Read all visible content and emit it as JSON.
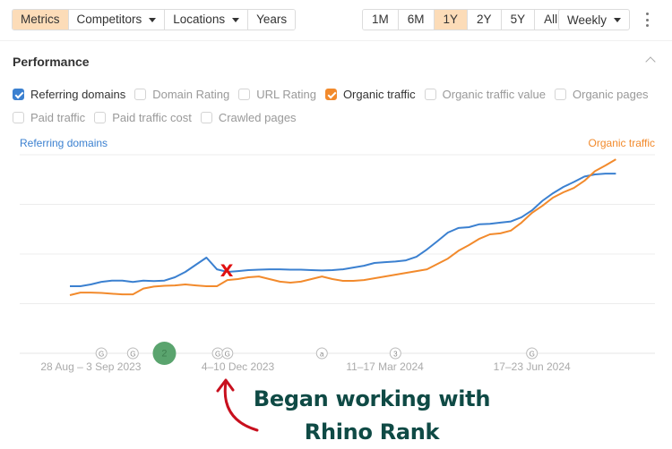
{
  "toolbar": {
    "tabs": [
      {
        "label": "Metrics",
        "active": true,
        "dropdown": false
      },
      {
        "label": "Competitors",
        "active": false,
        "dropdown": true
      },
      {
        "label": "Locations",
        "active": false,
        "dropdown": true
      },
      {
        "label": "Years",
        "active": false,
        "dropdown": false
      }
    ],
    "ranges": [
      {
        "label": "1M",
        "active": false
      },
      {
        "label": "6M",
        "active": false
      },
      {
        "label": "1Y",
        "active": true
      },
      {
        "label": "2Y",
        "active": false
      },
      {
        "label": "5Y",
        "active": false
      },
      {
        "label": "All",
        "active": false
      }
    ],
    "interval": "Weekly",
    "more_icon": "kebab-vertical-icon"
  },
  "section": {
    "title": "Performance",
    "collapse_icon": "chevron-up-icon"
  },
  "metrics": {
    "row1": [
      {
        "label": "Referring domains",
        "checked": true,
        "color": "#3b80d0"
      },
      {
        "label": "Domain Rating",
        "checked": false
      },
      {
        "label": "URL Rating",
        "checked": false
      },
      {
        "label": "Organic traffic",
        "checked": true,
        "color": "#f28a2c"
      },
      {
        "label": "Organic traffic value",
        "checked": false
      },
      {
        "label": "Organic pages",
        "checked": false
      }
    ],
    "row2": [
      {
        "label": "Paid traffic",
        "checked": false
      },
      {
        "label": "Paid traffic cost",
        "checked": false
      },
      {
        "label": "Crawled pages",
        "checked": false
      }
    ]
  },
  "annotation": {
    "marker": "X",
    "line1": "Began working with",
    "line2": "Rhino Rank",
    "marker_color": "#e01010",
    "text_color": "#0f4a45"
  },
  "chart_data": {
    "type": "line",
    "title": "Performance",
    "y_axis_left_label": "Referring domains",
    "y_axis_right_label": "Organic traffic",
    "y_tick_labels_visible": false,
    "ylim_normalized": [
      0,
      100
    ],
    "grid": true,
    "x_tick_labels": [
      "28 Aug – 3 Sep 2023",
      "4–10 Dec 2023",
      "11–17 Mar 2024",
      "17–23 Jun 2024"
    ],
    "x_tick_indices": [
      2,
      16,
      30,
      44
    ],
    "x_count": 53,
    "series": [
      {
        "name": "Referring domains",
        "color": "#3b80d0",
        "axis": "left",
        "values": [
          33.8,
          33.8,
          34.7,
          36,
          36.6,
          36.6,
          35.9,
          36.6,
          36.4,
          36.6,
          38.3,
          41,
          44.6,
          48.2,
          42.3,
          41,
          41.4,
          41.9,
          42.1,
          42.3,
          42.3,
          42.1,
          42.1,
          41.9,
          41.7,
          41.9,
          42.3,
          43.2,
          44.1,
          45.5,
          45.9,
          46.2,
          46.8,
          48.6,
          52.3,
          56.5,
          60.8,
          63.1,
          63.5,
          65,
          65.2,
          65.8,
          66.4,
          68.5,
          72,
          76.8,
          80.6,
          83.8,
          86.3,
          89,
          90.1,
          90.5,
          90.5
        ]
      },
      {
        "name": "Organic traffic",
        "color": "#f28a2c",
        "axis": "right",
        "values": [
          29.3,
          30.6,
          30.6,
          30.4,
          30,
          29.7,
          29.7,
          32.6,
          33.6,
          34,
          34.2,
          34.7,
          34.2,
          33.8,
          33.8,
          36.9,
          37.4,
          38.3,
          38.7,
          37.4,
          36.1,
          35.6,
          36.1,
          37.4,
          38.7,
          37.4,
          36.5,
          36.5,
          36.9,
          37.8,
          38.7,
          39.6,
          40.5,
          41.4,
          42.3,
          45,
          47.7,
          51.6,
          54.5,
          57.7,
          59.9,
          60.4,
          61.8,
          65.8,
          70.7,
          74.3,
          78.4,
          81.1,
          83.3,
          86.9,
          91.7,
          94.6,
          97.7
        ]
      }
    ],
    "event_markers": [
      {
        "label": "G",
        "index": 3,
        "highlighted": false
      },
      {
        "label": "G",
        "index": 6,
        "highlighted": false
      },
      {
        "label": "2",
        "index": 9,
        "highlighted": true
      },
      {
        "label": "G",
        "index": 14,
        "highlighted": false
      },
      {
        "label": "G",
        "index": 15,
        "highlighted": false
      },
      {
        "label": "a",
        "index": 24,
        "highlighted": false
      },
      {
        "label": "3",
        "index": 31,
        "highlighted": false
      },
      {
        "label": "G",
        "index": 44,
        "highlighted": false
      }
    ],
    "annotation_index": 15
  }
}
